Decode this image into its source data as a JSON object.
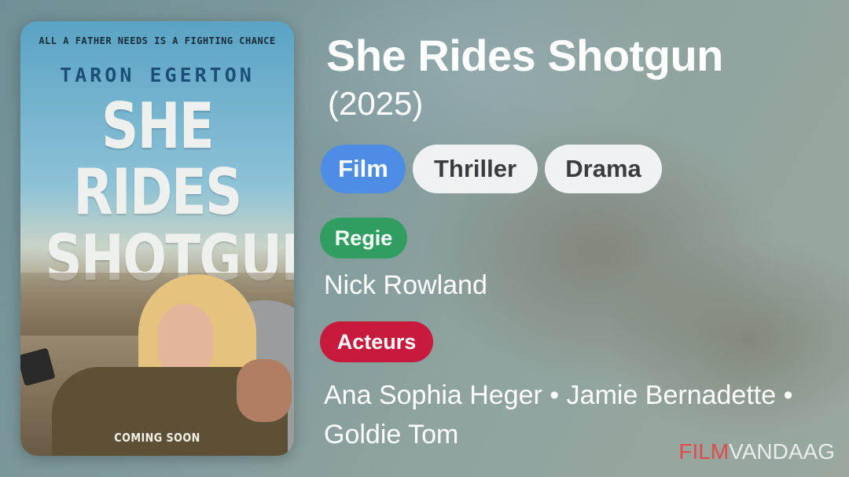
{
  "poster": {
    "tagline": "ALL A FATHER NEEDS IS A FIGHTING CHANCE",
    "actor": "TARON EGERTON",
    "title_line1": "SHE RIDES",
    "title_line2": "SHOTGUN",
    "footer": "COMING SOON"
  },
  "movie": {
    "title": "She Rides Shotgun",
    "year": "(2025)"
  },
  "tags": {
    "type": "Film",
    "genre1": "Thriller",
    "genre2": "Drama"
  },
  "director": {
    "label": "Regie",
    "name": "Nick Rowland"
  },
  "cast": {
    "label": "Acteurs",
    "names": "Ana Sophia Heger • Jamie Bernadette • Goldie Tom"
  },
  "branding": {
    "logo_part1": "FILM",
    "logo_part2": "VANDAAG"
  },
  "colors": {
    "film_pill": "#4d8de5",
    "genre_pill": "#eff1f3",
    "regie_label": "#2f9e60",
    "acteurs_label": "#c81a3d",
    "logo_accent": "#e24a4a"
  }
}
